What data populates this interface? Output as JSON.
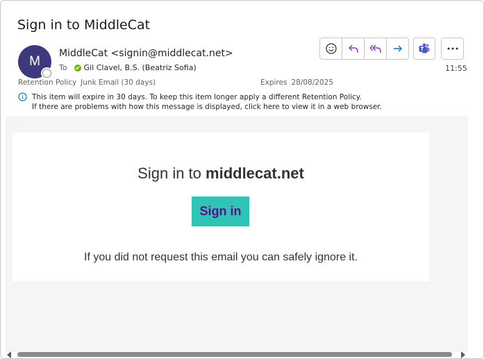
{
  "email": {
    "subject": "Sign in to MiddleCat",
    "avatar_initial": "M",
    "sender": "MiddleCat <signin@middlecat.net>",
    "to_label": "To",
    "recipient": "Gil Clavel, B.S. (Beatriz Sofia)",
    "time": "11:55",
    "retention_label": "Retention Policy",
    "retention_value": "Junk Email (30 days)",
    "expires_label": "Expires",
    "expires_value": "28/08/2025",
    "info_line1": "This item will expire in 30 days. To keep this item longer apply a different Retention Policy.",
    "info_line2": "If there are problems with how this message is displayed, click here to view it in a web browser."
  },
  "toolbar": {
    "icons": [
      "emoji-icon",
      "reply-icon",
      "reply-all-icon",
      "forward-icon",
      "teams-icon",
      "more-icon"
    ]
  },
  "content": {
    "title_prefix": "Sign in to ",
    "title_domain": "middlecat.net",
    "button_label": "Sign in",
    "ignore_text": "If you did not request this email you can safely ignore it."
  },
  "colors": {
    "avatar": "#3c3a7c",
    "button_bg": "#2ec4b6",
    "button_text": "#5a0f8f",
    "reply_purple": "#8a3ab9",
    "forward_blue": "#0f6cbd"
  }
}
